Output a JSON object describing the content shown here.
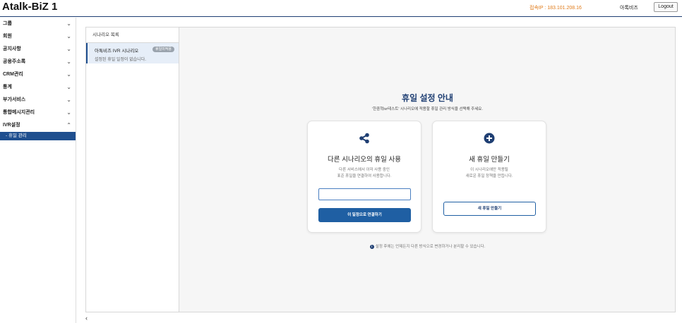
{
  "header": {
    "app_title": "Atalk-BiZ 1",
    "ip_text": "접속IP : 183.101.208.16",
    "user_name": "아톡비즈",
    "logout_label": "Logout"
  },
  "sidebar": {
    "items": [
      {
        "label": "그룹",
        "expanded": false
      },
      {
        "label": "회원",
        "expanded": false
      },
      {
        "label": "공지사항",
        "expanded": false
      },
      {
        "label": "공용주소록",
        "expanded": false
      },
      {
        "label": "CRM관리",
        "expanded": false
      },
      {
        "label": "통계",
        "expanded": false
      },
      {
        "label": "부가서비스",
        "expanded": false
      },
      {
        "label": "통합메시지관리",
        "expanded": false
      },
      {
        "label": "IVR설정",
        "expanded": true
      }
    ],
    "sub_items": [
      {
        "label": "- 휴일 관리"
      }
    ],
    "collapse_icon": "chevron-left-icon"
  },
  "scenario_panel": {
    "heading": "시나리오 목록",
    "items": [
      {
        "name": "아톡비즈 IVR 시나리오",
        "badge": "휴일미적용",
        "sub": "설정된 휴일 일정이 없습니다."
      }
    ]
  },
  "main": {
    "title": "휴일 설정 안내",
    "subtitle": "'한중혁ivr테스트' 시나리오에 적용할 휴일 관리 방식을 선택해 주세요.",
    "card_share": {
      "icon": "share-icon",
      "title": "다른 시나리오의 휴일 사용",
      "desc_line1": "다른 서비스에서 이미 사용 중인",
      "desc_line2": "표준 휴일을 연결하여 사용합니다.",
      "input_value": "",
      "button_label": "이 일정으로 연결하기"
    },
    "card_new": {
      "icon": "plus-circle-icon",
      "title": "새 휴일 만들기",
      "desc_line1": "이 시나리오에만 적용될",
      "desc_line2": "새로운 휴일 정책을 만듭니다.",
      "button_label": "새 휴일 만들기"
    },
    "note": "설정 후에는 언제든지 다른 방식으로 변경하거나 분리할 수 있습니다."
  },
  "colors": {
    "accent": "#1f3f73",
    "primary_button": "#1f5fa3",
    "ip_text": "#e07b1a",
    "badge": "#9aa3ad"
  }
}
